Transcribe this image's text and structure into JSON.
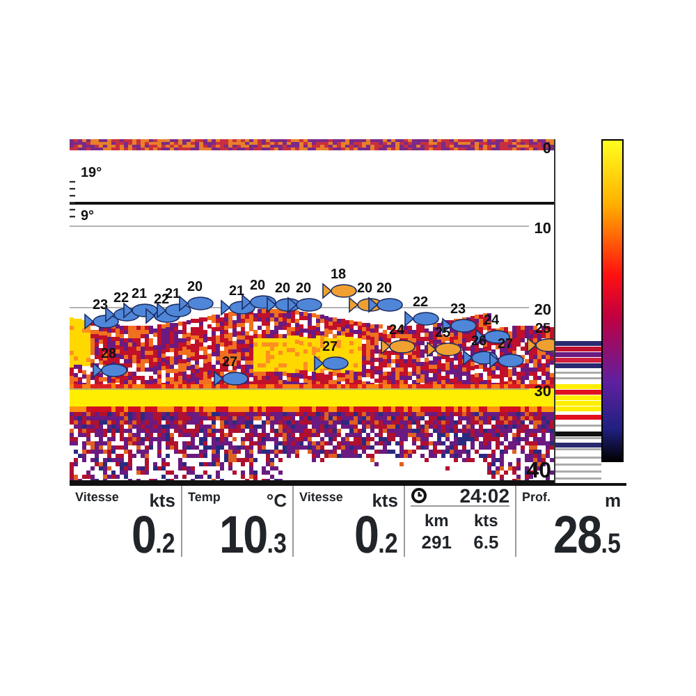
{
  "depth_scale": [
    "0",
    "10",
    "20",
    "30",
    "40"
  ],
  "temperature_marks": [
    "19°",
    "9°"
  ],
  "fish": [
    {
      "depth": "23",
      "color": "#4f86d8"
    },
    {
      "depth": "22",
      "color": "#4f86d8"
    },
    {
      "depth": "21",
      "color": "#4f86d8"
    },
    {
      "depth": "22",
      "color": "#4f86d8"
    },
    {
      "depth": "21",
      "color": "#4f86d8"
    },
    {
      "depth": "20",
      "color": "#4f86d8"
    },
    {
      "depth": "21",
      "color": "#4f86d8"
    },
    {
      "depth": "20",
      "color": "#4f86d8"
    },
    {
      "depth": "20",
      "color": "#4f86d8"
    },
    {
      "depth": "20",
      "color": "#4f86d8"
    },
    {
      "depth": "18",
      "color": "#f0a030"
    },
    {
      "depth": "20",
      "color": "#f0a030"
    },
    {
      "depth": "20",
      "color": "#4f86d8"
    },
    {
      "depth": "22",
      "color": "#4f86d8"
    },
    {
      "depth": "23",
      "color": "#4f86d8"
    },
    {
      "depth": "24",
      "color": "#4f86d8"
    },
    {
      "depth": "25",
      "color": "#f0a030"
    },
    {
      "depth": "26",
      "color": "#4f86d8"
    },
    {
      "depth": "27",
      "color": "#4f86d8"
    },
    {
      "depth": "28",
      "color": "#4f86d8"
    },
    {
      "depth": "27",
      "color": "#4f86d8"
    },
    {
      "depth": "27",
      "color": "#4f86d8"
    },
    {
      "depth": "24",
      "color": "#f0a030"
    },
    {
      "depth": "25",
      "color": "#f0a030"
    }
  ],
  "data_boxes": [
    {
      "kind": "value",
      "label": "Vitesse",
      "unit": "kts",
      "value": "0$_{.2}$"
    },
    {
      "kind": "value",
      "label": "Temp",
      "unit": "°C",
      "value": "10$_{.3}$"
    },
    {
      "kind": "value",
      "label": "Vitesse",
      "unit": "kts",
      "value": "0$_{.2}$"
    },
    {
      "kind": "trip",
      "time": "24:02",
      "columns": [
        {
          "unit": "km",
          "value": "291"
        },
        {
          "unit": "kts",
          "value": "6.5"
        }
      ]
    },
    {
      "kind": "value",
      "label": "Prof.",
      "unit": "m",
      "value": "28$_{.5}$"
    }
  ]
}
